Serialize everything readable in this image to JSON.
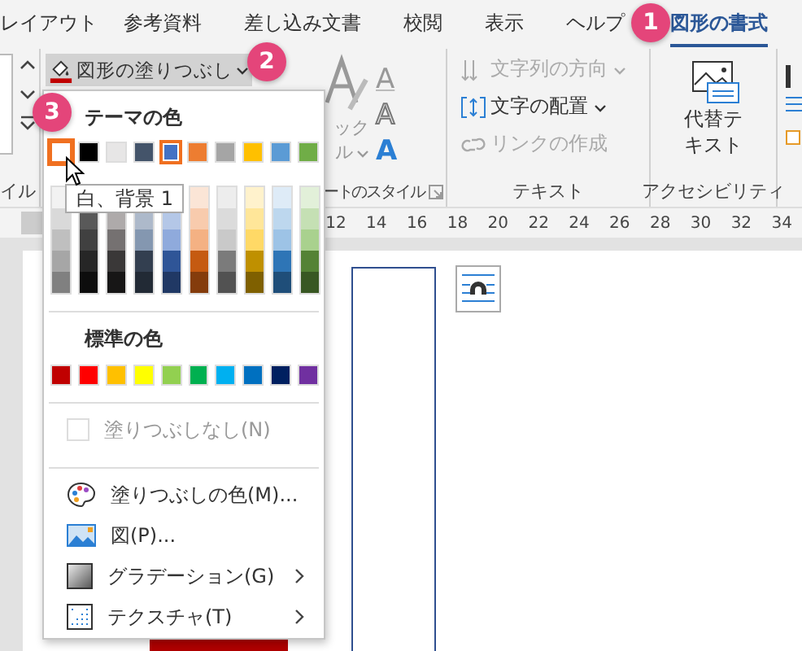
{
  "tabs": [
    {
      "label": "レイアウト",
      "selected": false
    },
    {
      "label": "参考資料",
      "selected": false
    },
    {
      "label": "差し込み文書",
      "selected": false
    },
    {
      "label": "校閲",
      "selected": false
    },
    {
      "label": "表示",
      "selected": false
    },
    {
      "label": "ヘルプ",
      "selected": false
    },
    {
      "label": "図形の書式",
      "selected": true
    }
  ],
  "ribbon": {
    "fill_button": {
      "label": "図形の塗りつぶし",
      "expanded": true
    },
    "quick_styles": [
      "ック",
      "ル"
    ],
    "text_effects": [
      "A",
      "A",
      "A"
    ],
    "text_items": [
      {
        "label": "文字列の方向",
        "disabled": true,
        "dropdown": true
      },
      {
        "label": "文字の配置",
        "disabled": false,
        "dropdown": true
      },
      {
        "label": "リンクの作成",
        "disabled": true,
        "dropdown": false
      }
    ],
    "alt_text": "代替テキスト",
    "group_labels": [
      "イル",
      "ートのスタイル",
      "テキスト",
      "アクセシビリティ"
    ]
  },
  "ruler": [
    "12",
    "14",
    "16",
    "18",
    "20",
    "22",
    "24",
    "26",
    "28",
    "30",
    "32",
    "34"
  ],
  "fill_menu": {
    "theme_heading": "テーマの色",
    "theme_colors": [
      {
        "color": "#ffffff",
        "selected": false,
        "hovered": true
      },
      {
        "color": "#000000",
        "selected": false,
        "hovered": false
      },
      {
        "color": "#e7e6e6",
        "selected": false,
        "hovered": false
      },
      {
        "color": "#44546a",
        "selected": false,
        "hovered": false
      },
      {
        "color": "#4472c4",
        "selected": true,
        "hovered": false
      },
      {
        "color": "#ed7d31",
        "selected": false,
        "hovered": false
      },
      {
        "color": "#a5a5a5",
        "selected": false,
        "hovered": false
      },
      {
        "color": "#ffc000",
        "selected": false,
        "hovered": false
      },
      {
        "color": "#5b9bd5",
        "selected": false,
        "hovered": false
      },
      {
        "color": "#70ad47",
        "selected": false,
        "hovered": false
      }
    ],
    "tints": [
      {
        "top_hidden": false,
        "colors": [
          {
            "color": "#f2f2f2"
          },
          {
            "color": "#d9d9d9"
          },
          {
            "color": "#bfbfbf"
          },
          {
            "color": "#a6a6a6"
          },
          {
            "color": "#808080"
          }
        ]
      },
      {
        "top_hidden": true,
        "colors": [
          {
            "color": "#595959"
          },
          {
            "color": "#404040"
          },
          {
            "color": "#262626"
          },
          {
            "color": "#0d0d0d"
          }
        ]
      },
      {
        "top_hidden": true,
        "colors": [
          {
            "color": "#aeaaaa"
          },
          {
            "color": "#757171"
          },
          {
            "color": "#3a3838"
          },
          {
            "color": "#171616"
          }
        ]
      },
      {
        "top_hidden": true,
        "colors": [
          {
            "color": "#adb9ca"
          },
          {
            "color": "#8497b0"
          },
          {
            "color": "#333f50"
          },
          {
            "color": "#222a35"
          }
        ]
      },
      {
        "top_hidden": true,
        "colors": [
          {
            "color": "#b4c7e7"
          },
          {
            "color": "#8faadc"
          },
          {
            "color": "#2f5597"
          },
          {
            "color": "#203864"
          }
        ]
      },
      {
        "top_hidden": false,
        "colors": [
          {
            "color": "#fbe5d6"
          },
          {
            "color": "#f8cbad"
          },
          {
            "color": "#f4b183"
          },
          {
            "color": "#c55a11"
          },
          {
            "color": "#843c0c"
          }
        ]
      },
      {
        "top_hidden": false,
        "colors": [
          {
            "color": "#ededed"
          },
          {
            "color": "#dbdbdb"
          },
          {
            "color": "#c9c9c9"
          },
          {
            "color": "#7b7b7b"
          },
          {
            "color": "#525252"
          }
        ]
      },
      {
        "top_hidden": false,
        "colors": [
          {
            "color": "#fff2cc"
          },
          {
            "color": "#ffe699"
          },
          {
            "color": "#ffd966"
          },
          {
            "color": "#bf9000"
          },
          {
            "color": "#7f6000"
          }
        ]
      },
      {
        "top_hidden": false,
        "colors": [
          {
            "color": "#deebf7"
          },
          {
            "color": "#bdd7ee"
          },
          {
            "color": "#9dc3e6"
          },
          {
            "color": "#2e75b6"
          },
          {
            "color": "#1f4e79"
          }
        ]
      },
      {
        "top_hidden": false,
        "colors": [
          {
            "color": "#e2f0d9"
          },
          {
            "color": "#c5e0b4"
          },
          {
            "color": "#a9d18e"
          },
          {
            "color": "#548235"
          },
          {
            "color": "#385723"
          }
        ]
      }
    ],
    "standard_heading": "標準の色",
    "standard_colors": [
      {
        "color": "#c00000"
      },
      {
        "color": "#ff0000"
      },
      {
        "color": "#ffc000"
      },
      {
        "color": "#ffff00"
      },
      {
        "color": "#92d050"
      },
      {
        "color": "#00b050"
      },
      {
        "color": "#00b0f0"
      },
      {
        "color": "#0070c0"
      },
      {
        "color": "#002060"
      },
      {
        "color": "#7030a0"
      }
    ],
    "items": [
      {
        "kind": "no_fill",
        "label": "塗りつぶしなし(N)",
        "disabled": true,
        "submenu": false
      },
      {
        "kind": "palette",
        "label": "塗りつぶしの色(M)...",
        "disabled": false,
        "submenu": false
      },
      {
        "kind": "picture",
        "label": "図(P)...",
        "disabled": false,
        "submenu": false
      },
      {
        "kind": "gradient",
        "label": "グラデーション(G)",
        "disabled": false,
        "submenu": true
      },
      {
        "kind": "texture",
        "label": "テクスチャ(T)",
        "disabled": false,
        "submenu": true
      }
    ]
  },
  "tooltip": "白、背景 1",
  "badges": [
    "1",
    "2",
    "3"
  ]
}
